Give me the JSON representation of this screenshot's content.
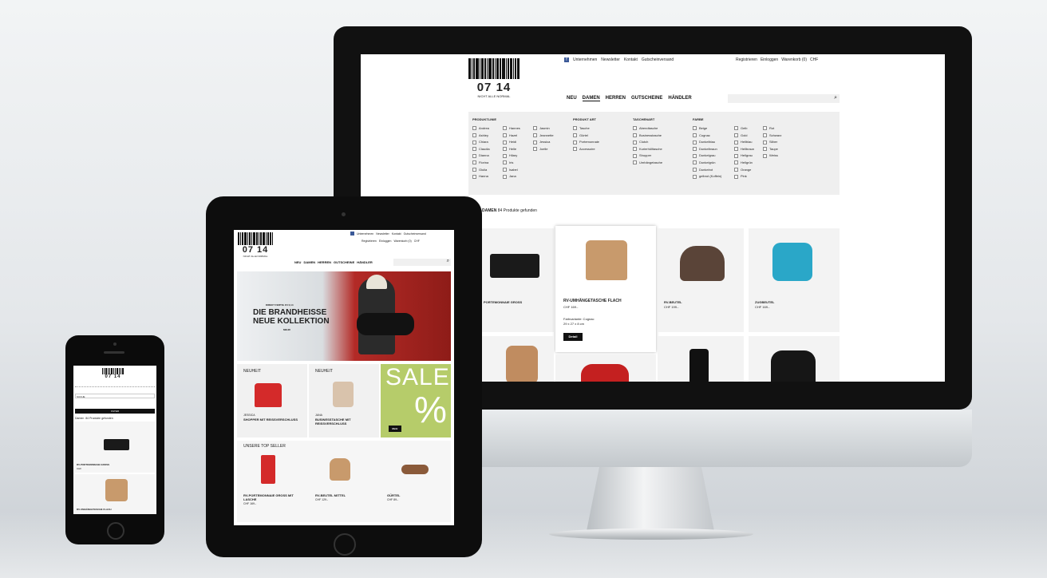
{
  "brand": {
    "logo_number": "07 14",
    "tagline": "NICHT ALLE NORMAL"
  },
  "monitor": {
    "top_links": [
      "Unternehmen",
      "Newsletter",
      "Kontakt",
      "Gutscheinversand"
    ],
    "account_links": [
      "Registrieren",
      "Einloggen",
      "Warenkorb (0)",
      "CHF"
    ],
    "nav": [
      "NEU",
      "DAMEN",
      "HERREN",
      "GUTSCHEINE",
      "HÄNDLER"
    ],
    "filters": {
      "produktlinie": {
        "title": "PRODUKTLINIE",
        "items": [
          "Andrea",
          "Ashley",
          "Chiara",
          "Claudia",
          "Dianna",
          "Florina",
          "Giulia",
          "Hanna",
          "Hannes",
          "Hazel",
          "Heidi",
          "Helle",
          "Hilary",
          "Iris",
          "Isabel",
          "Jana",
          "Jasmin",
          "Jeannette",
          "Jessica",
          "Joelle"
        ]
      },
      "produktart": {
        "title": "PRODUKT ART",
        "items": [
          "Tasche",
          "Gürtel",
          "Portemonnaie",
          "Accessoire"
        ]
      },
      "taschenart": {
        "title": "TASCHENART",
        "items": [
          "Abendtasche",
          "Businesstasche",
          "Clutch",
          "Kurierhülltasche",
          "Shopper",
          "Umhängetasche"
        ]
      },
      "farbe": {
        "title": "FARBE",
        "items": [
          "Beige",
          "Cognac",
          "Dunkelblau",
          "Dunkelbraun",
          "Dunkelgrau",
          "Dunkelgrün",
          "Dunkelrot",
          "gelbrot (Koffein)",
          "Gelb",
          "Gold",
          "Hellblau",
          "Hellbraun",
          "Hellgrau",
          "Hellgrün",
          "Orange",
          "Pink",
          "Rot",
          "Schwarz",
          "Silber",
          "Taupe",
          "Weiss"
        ]
      }
    },
    "results_label": "DAMEN",
    "results_count": "84 Produkte gefunden",
    "products": [
      {
        "name": "PORTEMONNAIE GROSS",
        "price": ""
      },
      {
        "name": "RV-UMHÄNGETASCHE FLACH",
        "price": "CHF 169.-",
        "detail1": "Farbvariante: Cognac",
        "detail2": "29 x 27 x 8 cm",
        "button": "Detail"
      },
      {
        "name": "RV-BEUTEL",
        "price": "CHF 199.-"
      },
      {
        "name": "ZUGBEUTEL",
        "price": "CHF 169.-"
      }
    ]
  },
  "tablet": {
    "top_links": [
      "Unternehmen",
      "Newsletter",
      "Kontakt",
      "Gutscheinversand"
    ],
    "account_links": [
      "Registrieren",
      "Einloggen",
      "Warenkorb (0)",
      "CHF"
    ],
    "nav": [
      "NEU",
      "DAMEN",
      "HERREN",
      "GUTSCHEINE",
      "HÄNDLER"
    ],
    "hero_kicker": "DIREKT FERTIG ZU 0,14",
    "hero_line1": "DIE BRANDHEISSE",
    "hero_line2": "NEUE KOLLEKTION",
    "hero_more": "MEHR",
    "tiles": [
      {
        "label": "NEUHEIT",
        "name": "SHOPPER MIT REISSVERSCHLUSS",
        "kicker": "JESSICA"
      },
      {
        "label": "NEUHEIT",
        "name": "BUSINESSTASCHE MIT REISSVERSCHLUSS",
        "kicker": "JANA"
      }
    ],
    "sale_text": "SALE",
    "sale_percent": "%",
    "sale_button": "Mehr",
    "topseller_title": "UNSERE TOP SELLER",
    "topsellers": [
      {
        "name": "RV-PORTEMONNAIE GROSS MIT LASCHE",
        "price": "CHF 169.-"
      },
      {
        "name": "RV-BEUTEL MITTEL",
        "price": "CHF 129.-"
      },
      {
        "name": "GÜRTEL",
        "price": "CHF 89.-"
      }
    ]
  },
  "phone": {
    "search_placeholder": "SUCHE",
    "filter_button": "FILTER",
    "results": "Damen  84 Produkte gefunden",
    "products": [
      {
        "name": "RV-PORTEMONNAIE GROSS",
        "price": "CHF"
      },
      {
        "name": "RV-UMHÄNGETASCHE FLACH",
        "price": ""
      }
    ]
  },
  "colors": {
    "accent": "#111111",
    "sale_green": "#b6cc6a",
    "bag_red": "#d42a2a",
    "bag_cognac": "#c89a6c",
    "bag_turquoise": "#2aa7c8"
  }
}
